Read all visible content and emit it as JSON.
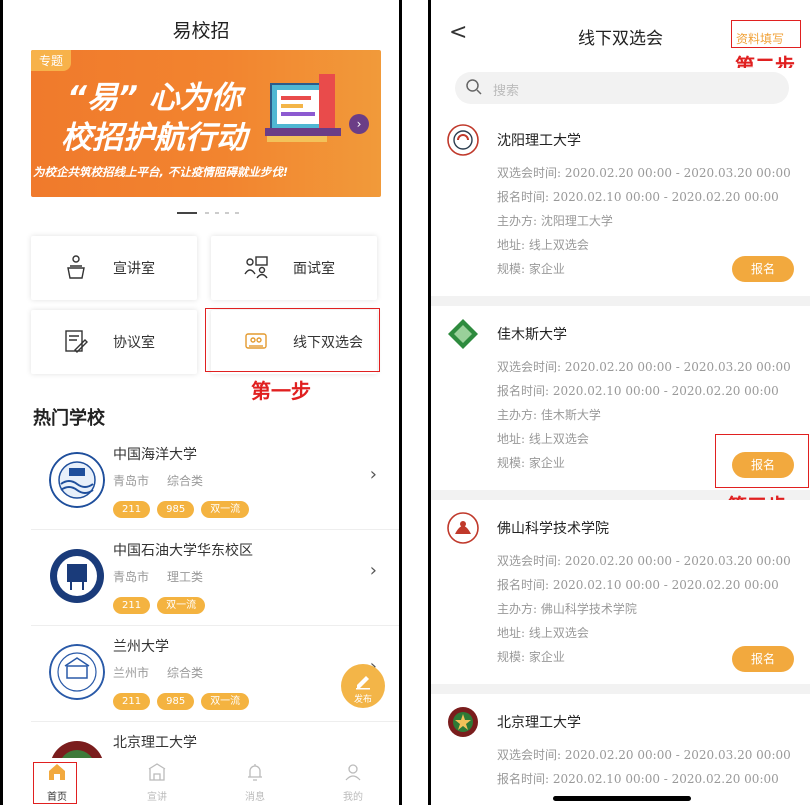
{
  "left": {
    "title": "易校招",
    "banner": {
      "tag": "专题",
      "line1": "“易” 心为你",
      "line2": "校招护航行动",
      "line3": "为校企共筑校招线上平台, 不让疫情阻碍就业步伐!"
    },
    "tiles": [
      {
        "label": "宣讲室",
        "icon": "podium-icon"
      },
      {
        "label": "面试室",
        "icon": "interview-icon"
      },
      {
        "label": "协议室",
        "icon": "agreement-icon"
      },
      {
        "label": "线下双选会",
        "icon": "job-fair-icon"
      }
    ],
    "step1": "第一步",
    "hot_title": "热门学校",
    "schools": [
      {
        "name": "中国海洋大学",
        "city": "青岛市",
        "type": "综合类",
        "tags": [
          "211",
          "985",
          "双一流"
        ]
      },
      {
        "name": "中国石油大学华东校区",
        "city": "青岛市",
        "type": "理工类",
        "tags": [
          "211",
          "双一流"
        ]
      },
      {
        "name": "兰州大学",
        "city": "兰州市",
        "type": "综合类",
        "tags": [
          "211",
          "985",
          "双一流"
        ]
      },
      {
        "name": "北京理工大学",
        "city": "",
        "type": "",
        "tags": []
      }
    ],
    "fab_label": "发布",
    "tabs": [
      {
        "label": "首页"
      },
      {
        "label": "宣讲"
      },
      {
        "label": "消息"
      },
      {
        "label": "我的"
      }
    ]
  },
  "right": {
    "title": "线下双选会",
    "fill_label": "资料填写",
    "step2": "第二步",
    "step3": "第三步",
    "search_placeholder": "搜索",
    "apply_label": "报名",
    "labels": {
      "fair_time": "双选会时间: ",
      "signup_time": "报名时间: ",
      "organizer": "主办方: ",
      "address": "地址: ",
      "scale": "规模: "
    },
    "cards": [
      {
        "name": "沈阳理工大学",
        "fair_time": "2020.02.20 00:00 - 2020.03.20 00:00",
        "signup_time": "2020.02.10 00:00 - 2020.02.20 00:00",
        "organizer": "沈阳理工大学",
        "address": "线上双选会",
        "scale": "家企业"
      },
      {
        "name": "佳木斯大学",
        "fair_time": "2020.02.20 00:00 - 2020.03.20 00:00",
        "signup_time": "2020.02.10 00:00 - 2020.02.20 00:00",
        "organizer": "佳木斯大学",
        "address": "线上双选会",
        "scale": "家企业"
      },
      {
        "name": "佛山科学技术学院",
        "fair_time": "2020.02.20 00:00 - 2020.03.20 00:00",
        "signup_time": "2020.02.10 00:00 - 2020.02.20 00:00",
        "organizer": "佛山科学技术学院",
        "address": "线上双选会",
        "scale": "家企业"
      },
      {
        "name": "北京理工大学",
        "fair_time": "2020.02.20 00:00 - 2020.03.20 00:00",
        "signup_time": "2020.02.10 00:00 - 2020.02.20 00:00",
        "organizer": "",
        "address": "",
        "scale": ""
      }
    ]
  },
  "colors": {
    "accent": "#f2a93e",
    "step_red": "#e02020",
    "banner": "#f07a2c"
  }
}
